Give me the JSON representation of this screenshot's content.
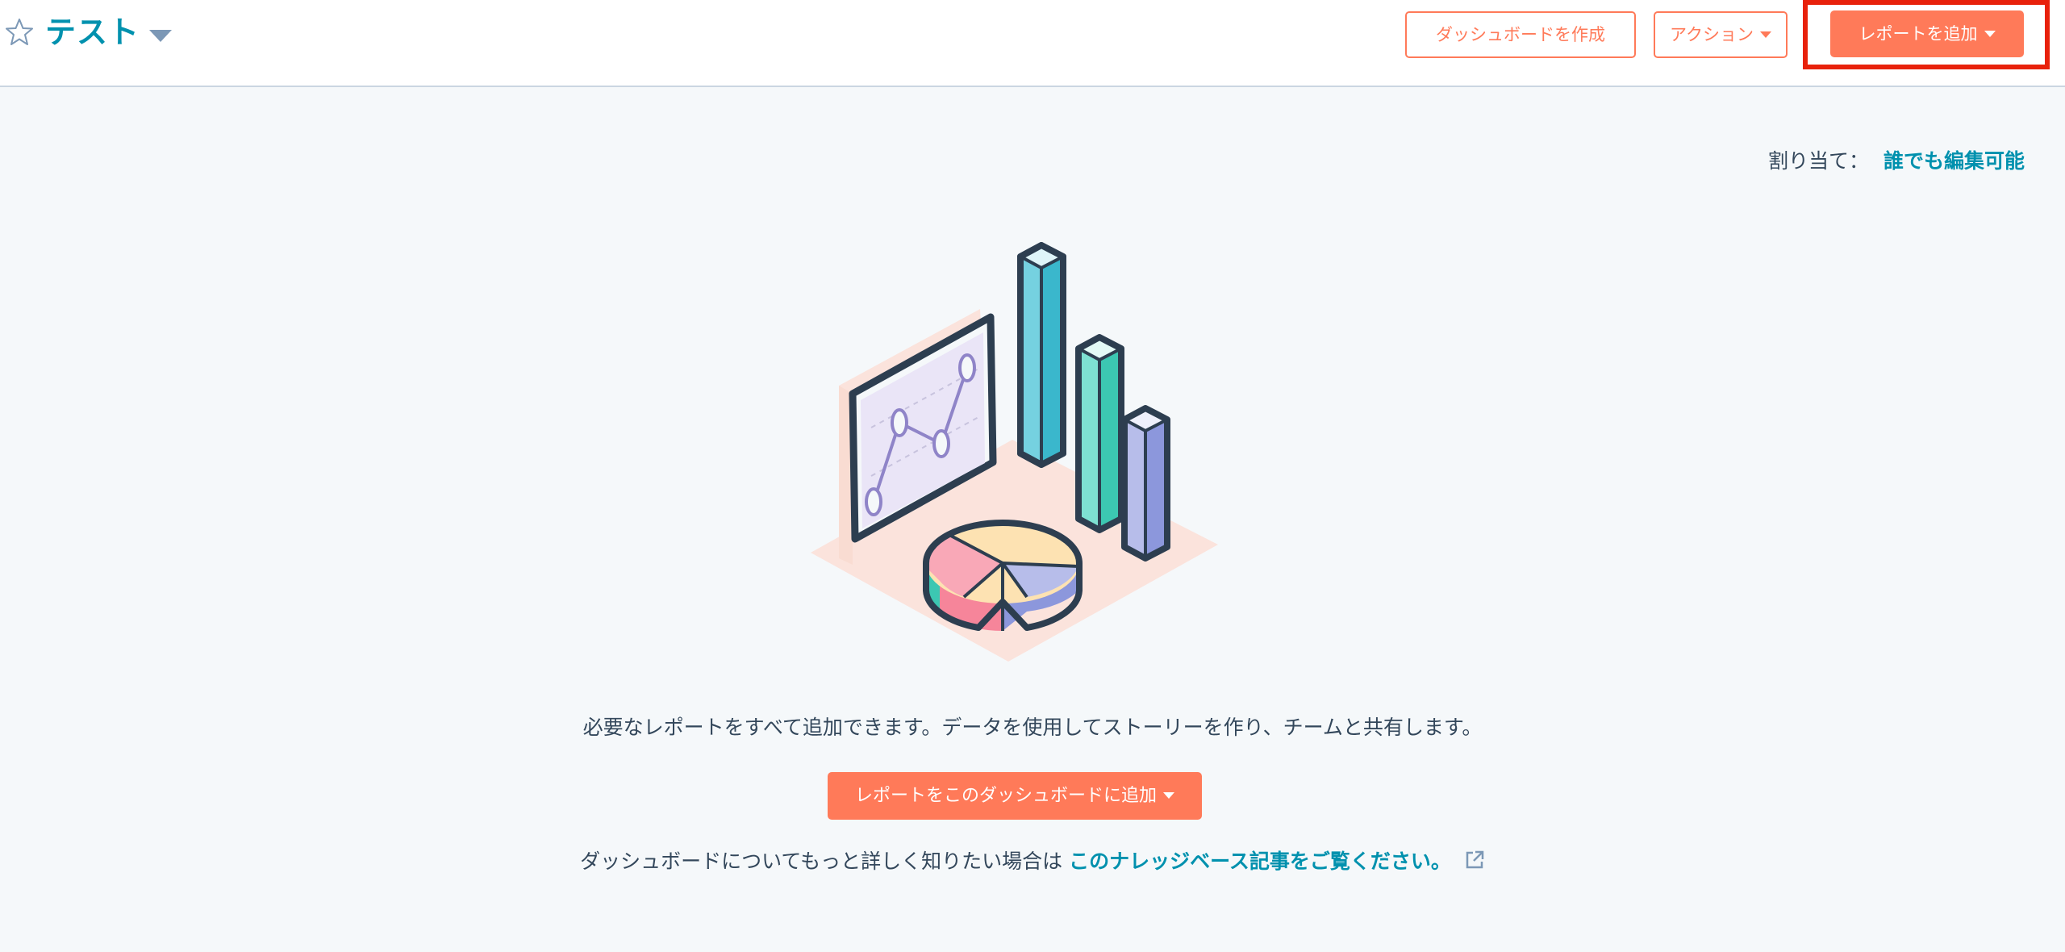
{
  "header": {
    "title": "テスト",
    "create_dashboard_label": "ダッシュボードを作成",
    "actions_label": "アクション",
    "add_report_label": "レポートを追加"
  },
  "assignment": {
    "label": "割り当て：",
    "value": "誰でも編集可能"
  },
  "empty_state": {
    "description": "必要なレポートをすべて追加できます。データを使用してストーリーを作り、チームと共有します。",
    "add_report_label": "レポートをこのダッシュボードに追加",
    "kb_text": "ダッシュボードについてもっと詳しく知りたい場合は",
    "kb_link": "このナレッジベース記事をご覧ください。"
  },
  "icons": {
    "favorite": "star-outline-icon",
    "title_menu": "caret-down-icon",
    "external_link": "external-link-icon",
    "illustration": "dashboard-charts-illustration"
  },
  "colors": {
    "accent": "#ff7a59",
    "link": "#0091ae",
    "text": "#33475b",
    "background": "#f5f8fa",
    "highlight": "#e8210b"
  }
}
